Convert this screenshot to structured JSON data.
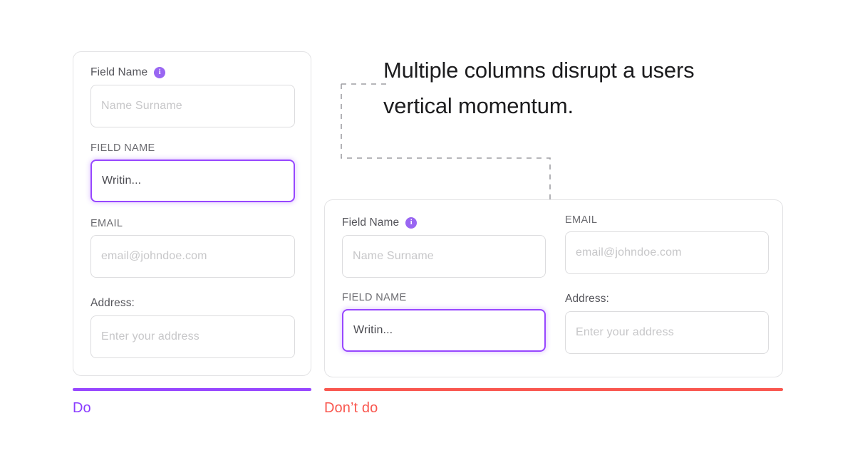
{
  "heading": {
    "text": "Multiple columns disrupt a users vertical momentum."
  },
  "do_example": {
    "caption": "Do",
    "accent_color": "#8B3DFF",
    "bar_color": "#9747FF",
    "fields": [
      {
        "label": "Field Name",
        "has_info_icon": true,
        "info_glyph": "i",
        "placeholder": "Name Surname",
        "value": "",
        "focused": false
      },
      {
        "label": "FIELD NAME",
        "has_info_icon": false,
        "placeholder": "",
        "value": "Writin...",
        "focused": true
      },
      {
        "label": "EMAIL",
        "has_info_icon": false,
        "placeholder": "email@johndoe.com",
        "value": "",
        "focused": false
      },
      {
        "label": "Address:",
        "has_info_icon": false,
        "placeholder": "Enter your address",
        "value": "",
        "focused": false
      }
    ]
  },
  "dont_example": {
    "caption": "Don’t do",
    "accent_color": "#F9574F",
    "bar_color": "#F9574F",
    "left_column": [
      {
        "label": "Field Name",
        "has_info_icon": true,
        "info_glyph": "i",
        "placeholder": "Name Surname",
        "value": "",
        "focused": false
      },
      {
        "label": "FIELD NAME",
        "has_info_icon": false,
        "placeholder": "",
        "value": "Writin...",
        "focused": true
      }
    ],
    "right_column": [
      {
        "label": "EMAIL",
        "has_info_icon": false,
        "placeholder": "email@johndoe.com",
        "value": "",
        "focused": false
      },
      {
        "label": "Address:",
        "has_info_icon": false,
        "placeholder": "Enter your address",
        "value": "",
        "focused": false
      }
    ]
  },
  "connector": {
    "style": "dashed",
    "color": "#9e9ea3",
    "shape": "l-bracket"
  }
}
